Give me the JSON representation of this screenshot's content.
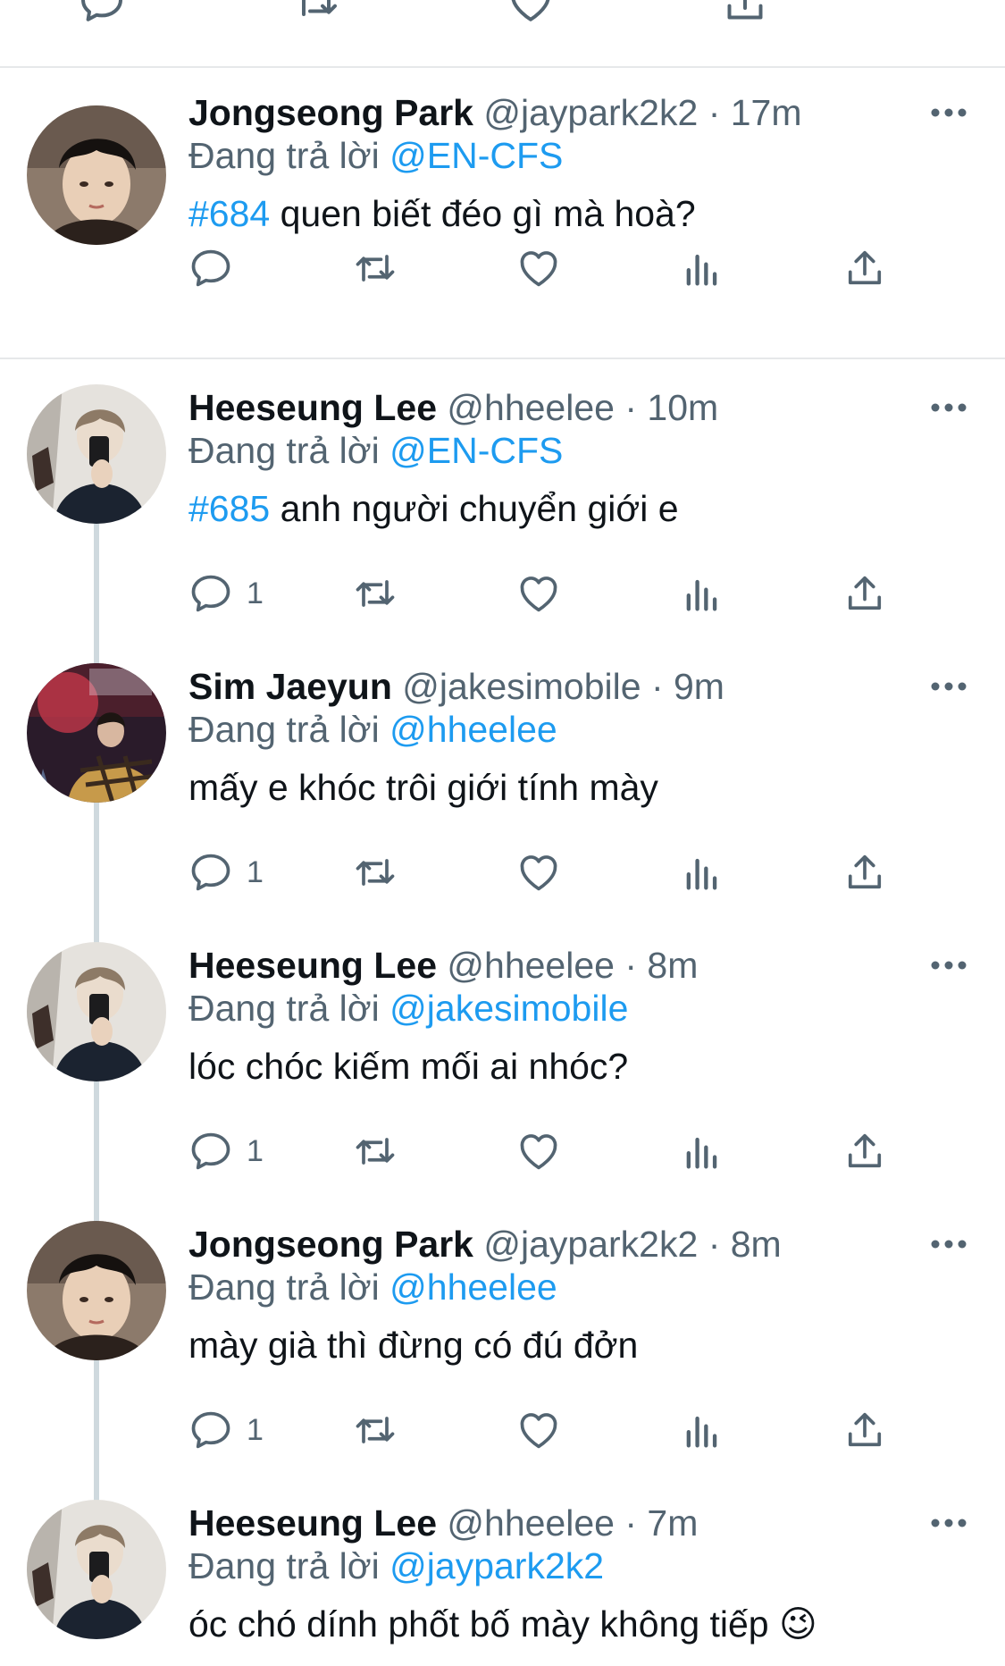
{
  "colors": {
    "accent": "#1d9bf0",
    "text_primary": "#0f1419",
    "text_secondary": "#536471",
    "divider": "#e6e8ea",
    "thread_line": "#cfd9de"
  },
  "icons": {
    "reply": "speech-bubble-icon",
    "retweet": "retweet-arrows-icon",
    "like": "heart-icon",
    "analytics": "bar-chart-icon",
    "share": "upload-arrow-icon",
    "more": "three-dots-icon"
  },
  "tweets": [
    {
      "name": "Jongseong Park",
      "handle": "@jaypark2k2",
      "time": "· 17m",
      "reply_prefix": "Đang trả lời",
      "reply_to": "@EN-CFS",
      "hashtag": "#684",
      "text": "quen biết đéo gì mà hoà?",
      "reply_count": ""
    },
    {
      "name": "Heeseung Lee",
      "handle": "@hheelee",
      "time": "· 10m",
      "reply_prefix": "Đang trả lời",
      "reply_to": "@EN-CFS",
      "hashtag": "#685",
      "text": "anh người chuyển giới e",
      "reply_count": "1"
    },
    {
      "name": "Sim Jaeyun",
      "handle": "@jakesimobile",
      "time": "· 9m",
      "reply_prefix": "Đang trả lời",
      "reply_to": "@hheelee",
      "hashtag": "",
      "text": "mấy e khóc trôi giới tính mày",
      "reply_count": "1"
    },
    {
      "name": "Heeseung Lee",
      "handle": "@hheelee",
      "time": "· 8m",
      "reply_prefix": "Đang trả lời",
      "reply_to": "@jakesimobile",
      "hashtag": "",
      "text": "lóc chóc kiếm mối ai nhóc?",
      "reply_count": "1"
    },
    {
      "name": "Jongseong Park",
      "handle": "@jaypark2k2",
      "time": "· 8m",
      "reply_prefix": "Đang trả lời",
      "reply_to": "@hheelee",
      "hashtag": "",
      "text": "mày già thì đừng có đú đởn",
      "reply_count": "1"
    },
    {
      "name": "Heeseung Lee",
      "handle": "@hheelee",
      "time": "· 7m",
      "reply_prefix": "Đang trả lời",
      "reply_to": "@jaypark2k2",
      "hashtag": "",
      "text": "óc chó dính phốt bố mày không tiếp 😉",
      "reply_count": ""
    }
  ]
}
